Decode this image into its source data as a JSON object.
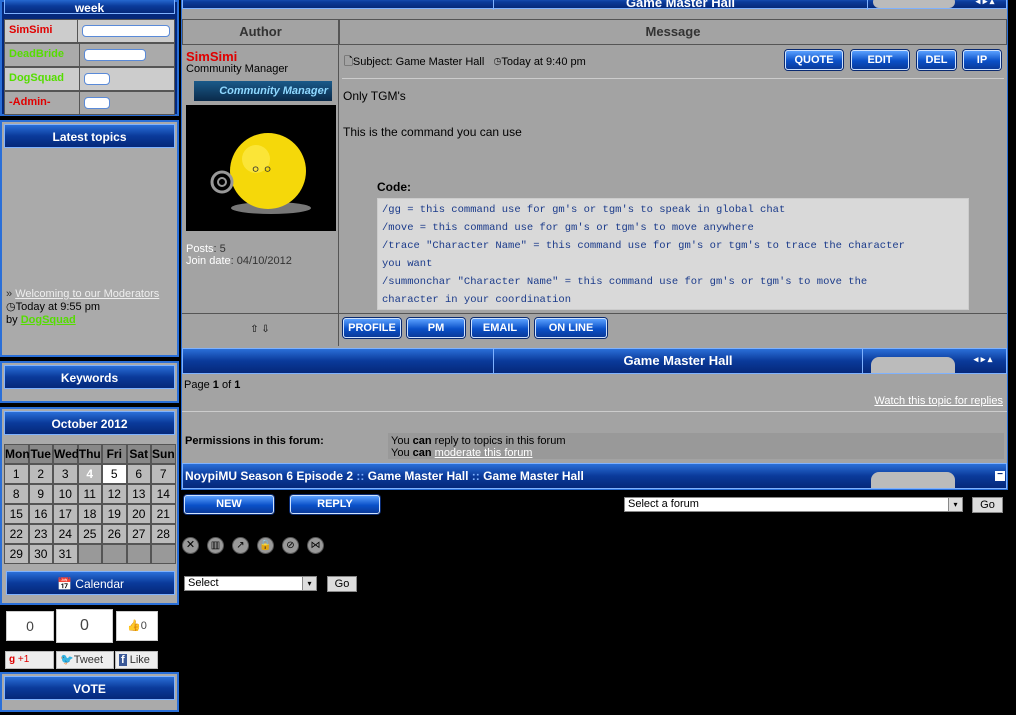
{
  "sidebar": {
    "week_header": "week",
    "top_users": [
      {
        "name": "SimSimi",
        "color": "#e00000"
      },
      {
        "name": "DeadBride",
        "color": "#55dd00"
      },
      {
        "name": "DogSquad",
        "color": "#55dd00"
      },
      {
        "name": "-Admin-",
        "color": "#e00000"
      }
    ],
    "latest_title": "Latest topics",
    "latest_link": "Welcoming to our Moderators",
    "latest_time": "Today at 9:55 pm",
    "latest_by": "by",
    "latest_user": "DogSquad",
    "keywords_title": "Keywords",
    "calendar_title": "October 2012",
    "days": [
      "Mon",
      "Tue",
      "Wed",
      "Thu",
      "Fri",
      "Sat",
      "Sun"
    ],
    "weeks": [
      [
        "1",
        "2",
        "3",
        "4",
        "5",
        "6",
        "7"
      ],
      [
        "8",
        "9",
        "10",
        "11",
        "12",
        "13",
        "14"
      ],
      [
        "15",
        "16",
        "17",
        "18",
        "19",
        "20",
        "21"
      ],
      [
        "22",
        "23",
        "24",
        "25",
        "26",
        "27",
        "28"
      ],
      [
        "29",
        "30",
        "31",
        "",
        "",
        "",
        ""
      ]
    ],
    "calendar_button": "Calendar",
    "social": {
      "count1": "0",
      "count2": "0",
      "like_count": "0",
      "gplus": "+1",
      "tweet": "Tweet",
      "like": "Like"
    },
    "vote_title": "VOTE"
  },
  "topbar_title": "Game Master Hall",
  "table": {
    "col_author": "Author",
    "col_message": "Message"
  },
  "post": {
    "author": "SimSimi",
    "rank": "Community Manager",
    "rank_badge": "Community Manager",
    "posts_label": "Posts",
    "posts": "5",
    "join_label": "Join date",
    "join_date": "04/10/2012",
    "subject_label": "Subject:",
    "subject": "Game Master Hall",
    "time": "Today at 9:40 pm",
    "buttons": [
      "QUOTE",
      "EDIT",
      "DEL",
      "IP"
    ],
    "line1": "Only TGM's",
    "line2": "This is the command you can use",
    "code_label": "Code:",
    "code": [
      "/gg = this command use for gm's or tgm's to speak in global chat",
      "/move = this command use for gm's or tgm's to move anywhere",
      "/trace \"Character Name\" = this command use for gm's or tgm's to trace the character",
      "you want",
      "/summonchar \"Character Name\" = this command use for gm's or tgm's to move the",
      "character in your coordination"
    ],
    "profile_buttons": [
      "PROFILE",
      "PM",
      "EMAIL",
      "ON LINE"
    ]
  },
  "bottom_title": "Game Master Hall",
  "page_label": "Page",
  "page_cur": "1",
  "page_of": "of",
  "page_total": "1",
  "watch_link": "Watch this topic for replies",
  "perm_title": "Permissions in this forum:",
  "perm1": {
    "a": "You",
    "b": "can",
    "c": "reply to topics in this forum"
  },
  "perm2": {
    "a": "You",
    "b": "can",
    "c": "moderate this forum"
  },
  "breadcrumb": [
    "NoypiMU Season 6 Episode 2",
    "Game Master Hall",
    "Game Master Hall"
  ],
  "btn_new": "NEW",
  "btn_reply": "REPLY",
  "forum_select": "Select a forum",
  "go": "Go",
  "mod_select": "Select",
  "go2": "Go"
}
